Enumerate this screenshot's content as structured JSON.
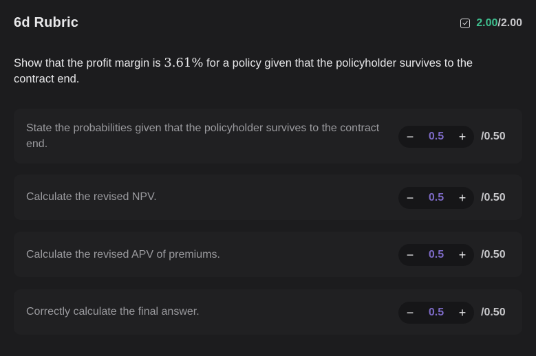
{
  "header": {
    "title": "6d Rubric",
    "score_earned": "2.00",
    "score_separator": "/",
    "score_total": "2.00"
  },
  "prompt": {
    "before": "Show that the profit margin is ",
    "math": "3.61%",
    "after": " for a policy given that the policyholder survives to the contract end."
  },
  "criteria": [
    {
      "label": "State the probabilities given that the policyholder survives to the contract end.",
      "minus": "−",
      "value": "0.5",
      "plus": "+",
      "max": "/0.50"
    },
    {
      "label": "Calculate the revised NPV.",
      "minus": "−",
      "value": "0.5",
      "plus": "+",
      "max": "/0.50"
    },
    {
      "label": "Calculate the revised APV of premiums.",
      "minus": "−",
      "value": "0.5",
      "plus": "+",
      "max": "/0.50"
    },
    {
      "label": "Correctly calculate the final answer.",
      "minus": "−",
      "value": "0.5",
      "plus": "+",
      "max": "/0.50"
    }
  ],
  "colors": {
    "earned": "#3fbf8f",
    "stepper_value": "#7d6ac6"
  },
  "icons": {
    "score": "checkbox-checked-icon"
  }
}
